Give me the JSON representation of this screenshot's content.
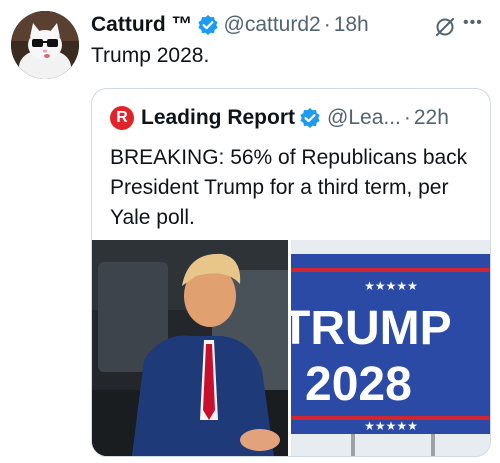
{
  "tweet": {
    "author_name": "Catturd ™",
    "handle": "@catturd2",
    "time": "18h",
    "separator": "·",
    "text": "Trump 2028."
  },
  "quote": {
    "source_logo_letter": "R",
    "author_name": "Leading Report",
    "handle": "@Lea...",
    "time": "22h",
    "separator": "·",
    "text": "BREAKING: 56% of Republicans back President Trump for a third term, per Yale poll."
  },
  "sign": {
    "line1": "TRUMP",
    "line2": "2028"
  },
  "icons": {
    "verified": "verified-badge-icon",
    "grok": "grok-icon",
    "more": "more-icon"
  },
  "colors": {
    "verified": "#1d9bf0",
    "secondary_text": "#536471",
    "border": "#cfd9de",
    "logo_red": "#e0242b",
    "sign_blue": "#2a4aa6",
    "sign_red": "#d0262f"
  }
}
